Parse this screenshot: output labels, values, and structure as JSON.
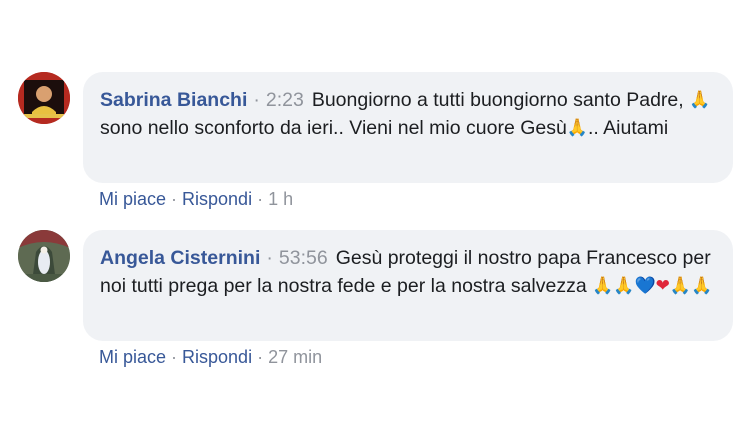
{
  "comments": [
    {
      "author": "Sabrina Bianchi",
      "time": "2:23",
      "text_1": "Buongiorno a tutti buongiorno santo Padre, ",
      "text_2": "sono nello sconforto da ieri.. Vieni nel mio cuore Gesù",
      "text_3": ".. Aiutami",
      "like_label": "Mi piace",
      "reply_label": "Rispondi",
      "age": "1 h"
    },
    {
      "author": "Angela Cisternini",
      "time": "53:56",
      "text": "Gesù proteggi il nostro papa Francesco per noi tutti prega per la nostra fede e per la nostra salvezza ",
      "like_label": "Mi piace",
      "reply_label": "Rispondi",
      "age": "27 min"
    }
  ],
  "separator": "·",
  "icons": {
    "pray": "🙏",
    "blue_heart": "💙",
    "red_heart": "❤"
  },
  "colors": {
    "author": "#385898",
    "meta": "#90949c",
    "bubble": "#f0f2f5"
  }
}
